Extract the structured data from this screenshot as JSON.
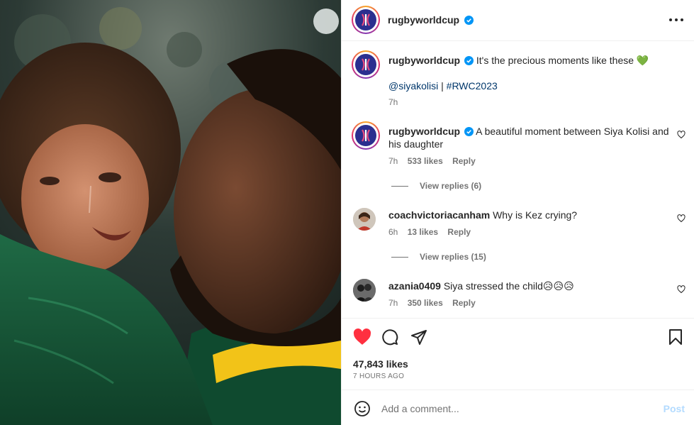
{
  "post": {
    "account": "rugbyworldcup",
    "more_icon": "more-horizontal-icon"
  },
  "caption": {
    "username": "rugbyworldcup",
    "text": "It's the precious moments like these",
    "emoji": "💚",
    "mention": "@siyakolisi",
    "separator": "|",
    "hashtag": "#RWC2023",
    "age": "7h"
  },
  "comments": [
    {
      "username": "rugbyworldcup",
      "text": "A beautiful moment between Siya Kolisi and his daughter",
      "age": "7h",
      "likes": "533 likes",
      "reply": "Reply",
      "view_replies": "View replies (6)"
    },
    {
      "username": "coachvictoriacanham",
      "text": "Why is Kez crying?",
      "age": "6h",
      "likes": "13 likes",
      "reply": "Reply",
      "view_replies": "View replies (15)"
    },
    {
      "username": "azania0409",
      "text": "Siya stressed the child",
      "emojis": "😥😥😥",
      "age": "7h",
      "likes": "350 likes",
      "reply": "Reply"
    }
  ],
  "actions": {
    "likes": "47,843 likes",
    "time": "7 HOURS AGO"
  },
  "add_comment": {
    "placeholder": "Add a comment...",
    "post_label": "Post"
  },
  "colors": {
    "like_red": "#ff3040",
    "verified_blue": "#0095f6",
    "link_blue": "#00376b",
    "post_disabled": "#b3dbff",
    "rwc_blue": "#2b2f8f"
  }
}
